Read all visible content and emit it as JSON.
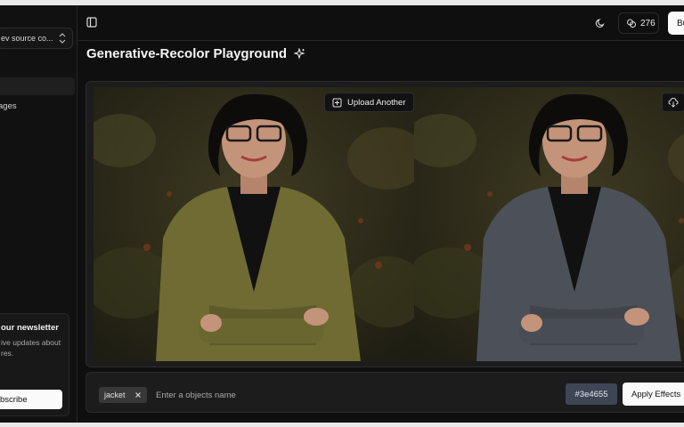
{
  "sidebar": {
    "project_selector": "ev source co...",
    "nav_item_images": "ages",
    "newsletter": {
      "title": "our newsletter",
      "description": "ive updates about res.",
      "subscribe_label": "bscribe"
    }
  },
  "header": {
    "credits": "276",
    "buy_label": "Bu"
  },
  "page": {
    "title": "Generative-Recolor Playground"
  },
  "image_panel": {
    "upload_label": "Upload Another"
  },
  "controls": {
    "tags": [
      {
        "label": "jacket"
      }
    ],
    "object_input_placeholder": "Enter a objects name",
    "color_value": "#3e4655",
    "apply_label": "Apply Effects"
  },
  "colors": {
    "background": "#0f0f0f",
    "original_jacket": "#6f6b33",
    "recolored_jacket": "#4c5058",
    "selected_color": "#3e4655"
  },
  "icons": [
    "chevron-up-down-icon",
    "sidebar-toggle-icon",
    "moon-icon",
    "coins-icon",
    "sparkle-icon",
    "add-image-icon",
    "download-cloud-icon",
    "close-icon"
  ]
}
